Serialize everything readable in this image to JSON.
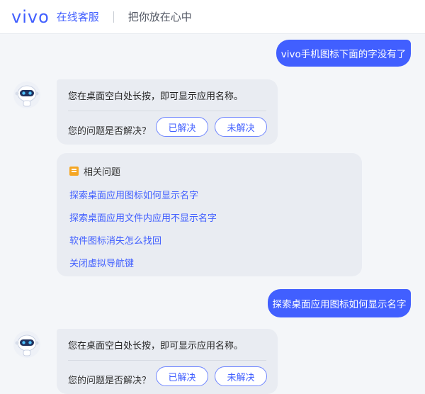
{
  "header": {
    "logo": "vivo",
    "service": "在线客服",
    "slogan": "把你放在心中"
  },
  "messages": {
    "user1": "vivo手机图标下面的字没有了",
    "bot1": {
      "text": "您在桌面空白处长按，即可显示应用名称。",
      "question": "您的问题是否解决？",
      "resolved": "已解决",
      "unresolved": "未解决"
    },
    "related": {
      "title": "相关问题",
      "items": [
        "探索桌面应用图标如何显示名字",
        "探索桌面应用文件内应用不显示名字",
        "软件图标消失怎么找回",
        "关闭虚拟导航键"
      ]
    },
    "user2": "探索桌面应用图标如何显示名字",
    "bot2": {
      "text": "您在桌面空白处长按，即可显示应用名称。",
      "question": "您的问题是否解决？",
      "resolved": "已解决",
      "unresolved": "未解决"
    }
  },
  "colors": {
    "brand": "#415fff",
    "card_bg": "#e9ecf2",
    "chat_bg": "#f4f6f9",
    "related_icon": "#f5a623"
  },
  "icons": {
    "bot_avatar": "robot-avatar-icon",
    "related": "document-icon"
  }
}
